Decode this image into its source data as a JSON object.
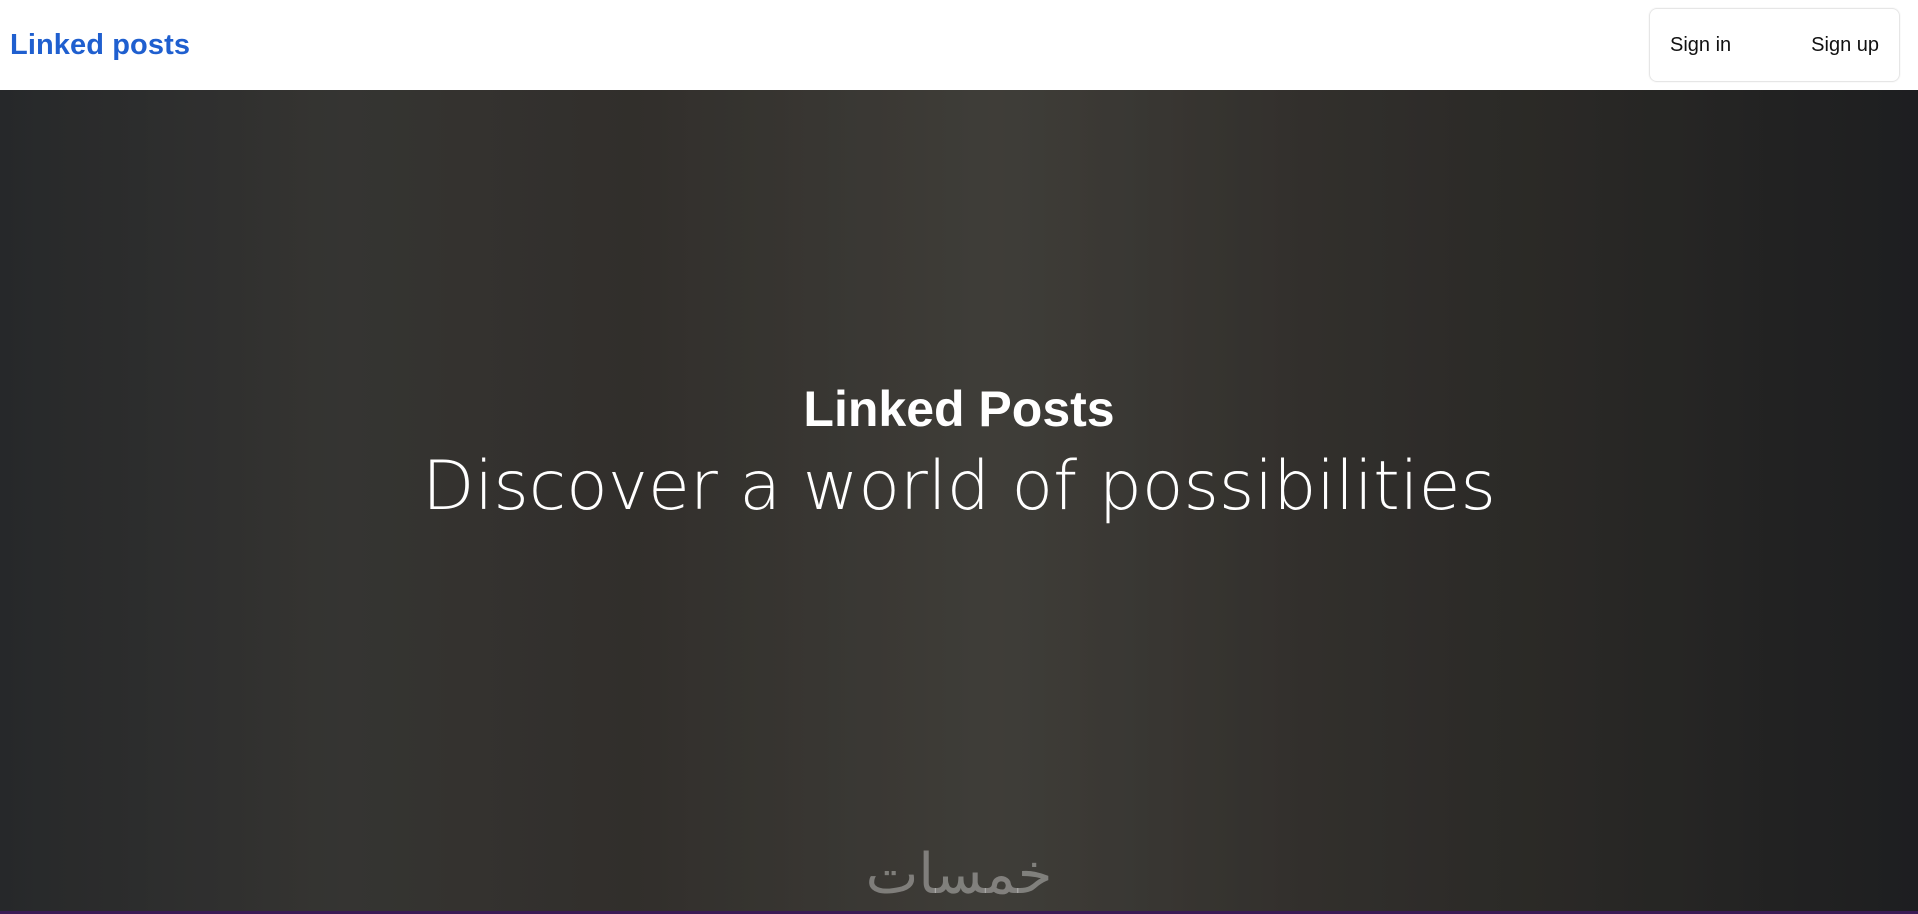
{
  "header": {
    "brand": "Linked posts",
    "sign_in_label": "Sign in",
    "sign_up_label": "Sign up"
  },
  "hero": {
    "title": "Linked Posts",
    "subtitle": "Discover a world of possibilities",
    "watermark": "خمسات"
  },
  "colors": {
    "brand": "#1f5fcf",
    "hero_text": "#ffffff"
  }
}
